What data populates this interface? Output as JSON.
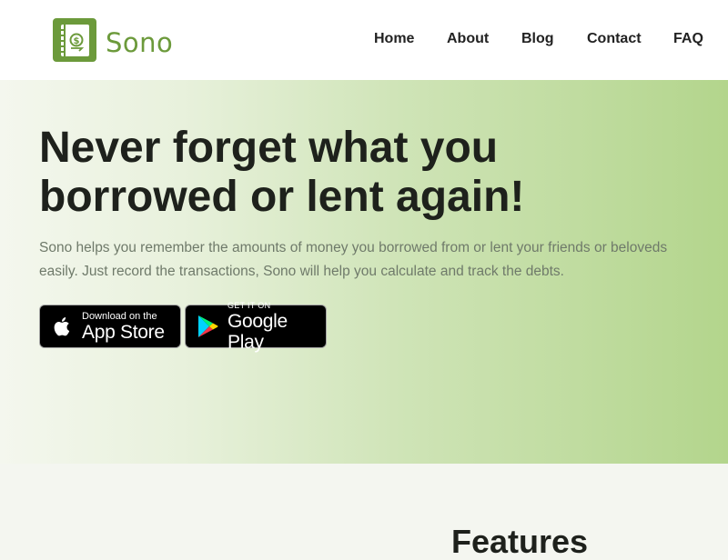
{
  "header": {
    "logo_text": "Sono",
    "logo_icon": "wallet-book-icon",
    "brand_color": "#6c9a3b",
    "nav": [
      {
        "label": "Home"
      },
      {
        "label": "About"
      },
      {
        "label": "Blog"
      },
      {
        "label": "Contact"
      },
      {
        "label": "FAQ"
      }
    ]
  },
  "hero": {
    "title": "Never forget what you borrowed or lent again!",
    "description": "Sono helps you remember the amounts of money you borrowed from or lent your friends or beloveds easily. Just record the transactions, Sono will help you calculate and track the debts.",
    "app_store": {
      "small_label": "Download on the",
      "big_label": "App Store",
      "icon": "apple-icon"
    },
    "google_play": {
      "small_label": "GET IT ON",
      "big_label": "Google Play",
      "icon": "google-play-icon"
    }
  },
  "features": {
    "title": "Features"
  }
}
